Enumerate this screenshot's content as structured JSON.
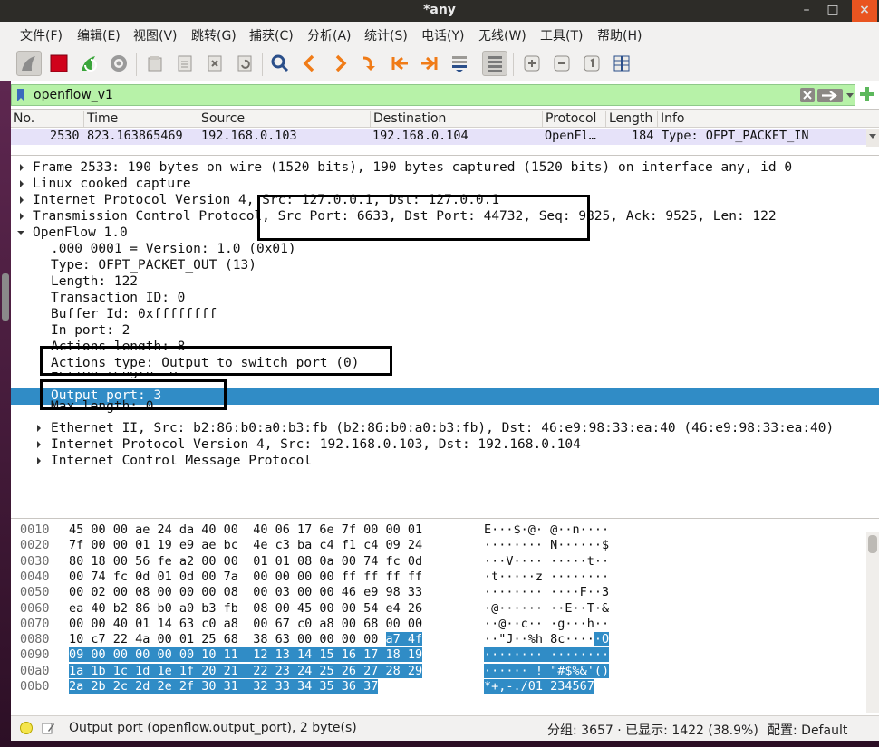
{
  "window": {
    "title": "*any",
    "minimize": "–",
    "maximize": "□",
    "close": "×"
  },
  "menu": [
    "文件(F)",
    "编辑(E)",
    "视图(V)",
    "跳转(G)",
    "捕获(C)",
    "分析(A)",
    "统计(S)",
    "电话(Y)",
    "无线(W)",
    "工具(T)",
    "帮助(H)"
  ],
  "filter": {
    "value": "openflow_v1"
  },
  "packet_list": {
    "columns": [
      "No.",
      "Time",
      "Source",
      "Destination",
      "Protocol",
      "Length",
      "Info"
    ],
    "row": {
      "no": "2530",
      "time": "823.163865469",
      "source": "192.168.0.103",
      "destination": "192.168.0.104",
      "protocol": "OpenFl…",
      "length": "184",
      "info": "Type: OFPT_PACKET_IN"
    }
  },
  "details": [
    "Frame 2533: 190 bytes on wire (1520 bits), 190 bytes captured (1520 bits) on interface any, id 0",
    "Linux cooked capture",
    "Internet Protocol Version 4, Src: 127.0.0.1, Dst: 127.0.0.1",
    "Transmission Control Protocol, Src Port: 6633, Dst Port: 44732, Seq: 9825, Ack: 9525, Len: 122",
    "OpenFlow 1.0",
    ".000 0001 = Version: 1.0 (0x01)",
    "Type: OFPT_PACKET_OUT (13)",
    "Length: 122",
    "Transaction ID: 0",
    "Buffer Id: 0xffffffff",
    "In port: 2",
    "Actions length: 8",
    "Actions type: Output to switch port (0)",
    "Action length: 8",
    "Output port: 3",
    "Max length: 0",
    "Ethernet II, Src: b2:86:b0:a0:b3:fb (b2:86:b0:a0:b3:fb), Dst: 46:e9:98:33:ea:40 (46:e9:98:33:ea:40)",
    "Internet Protocol Version 4, Src: 192.168.0.103, Dst: 192.168.0.104",
    "Internet Control Message Protocol"
  ],
  "hex": [
    {
      "offset": "0010",
      "b1": "45 00 00 ae 24 da 40 00  40 06 17 6e 7f 00 00 01",
      "hl": "",
      "a1": "E···$·@· @··n····",
      "ahl": ""
    },
    {
      "offset": "0020",
      "b1": "7f 00 00 01 19 e9 ae bc  4e c3 ba c4 f1 c4 09 24",
      "hl": "",
      "a1": "········ N······$",
      "ahl": ""
    },
    {
      "offset": "0030",
      "b1": "80 18 00 56 fe a2 00 00  01 01 08 0a 00 74 fc 0d",
      "hl": "",
      "a1": "···V···· ·····t··",
      "ahl": ""
    },
    {
      "offset": "0040",
      "b1": "00 74 fc 0d 01 0d 00 7a  00 00 00 00 ff ff ff ff",
      "hl": "",
      "a1": "·t·····z ········",
      "ahl": ""
    },
    {
      "offset": "0050",
      "b1": "00 02 00 08 00 00 00 08  00 03 00 00 46 e9 98 33",
      "hl": "",
      "a1": "········ ····F··3",
      "ahl": ""
    },
    {
      "offset": "0060",
      "b1": "ea 40 b2 86 b0 a0 b3 fb  08 00 45 00 00 54 e4 26",
      "hl": "",
      "a1": "·@······ ··E··T·&",
      "ahl": ""
    },
    {
      "offset": "0070",
      "b1": "00 00 40 01 14 63 c0 a8  00 67 c0 a8 00 68 00 00",
      "hl": "",
      "a1": "··@··c·· ·g···h··",
      "ahl": ""
    },
    {
      "offset": "0080",
      "b1": "10 c7 22 4a 00 01 25 68  38 63 00 00 00 00 ",
      "hl": "a7 4f",
      "a1": "··\"J··%h 8c····",
      "ahl": "·O"
    },
    {
      "offset": "0090",
      "b1": "",
      "hl": "09 00 00 00 00 00 10 11  12 13 14 15 16 17 18 19",
      "a1": "",
      "ahl": "········ ········"
    },
    {
      "offset": "00a0",
      "b1": "",
      "hl": "1a 1b 1c 1d 1e 1f 20 21  22 23 24 25 26 27 28 29",
      "a1": "",
      "ahl": "······ ! \"#$%&'()"
    },
    {
      "offset": "00b0",
      "b1": "",
      "hl": "2a 2b 2c 2d 2e 2f 30 31  32 33 34 35 36 37",
      "a1": "",
      "ahl": "*+,-./01 234567"
    }
  ],
  "status": {
    "field": "Output port (openflow.output_port), 2 byte(s)",
    "stats": "分组: 3657 · 已显示: 1422 (38.9%)",
    "profile": "配置:  Default"
  },
  "colors": {
    "selection": "#308cc6",
    "filter_ok": "#b7f2a8",
    "row_bg": "#e6e2f9",
    "stop": "#d0021b"
  }
}
